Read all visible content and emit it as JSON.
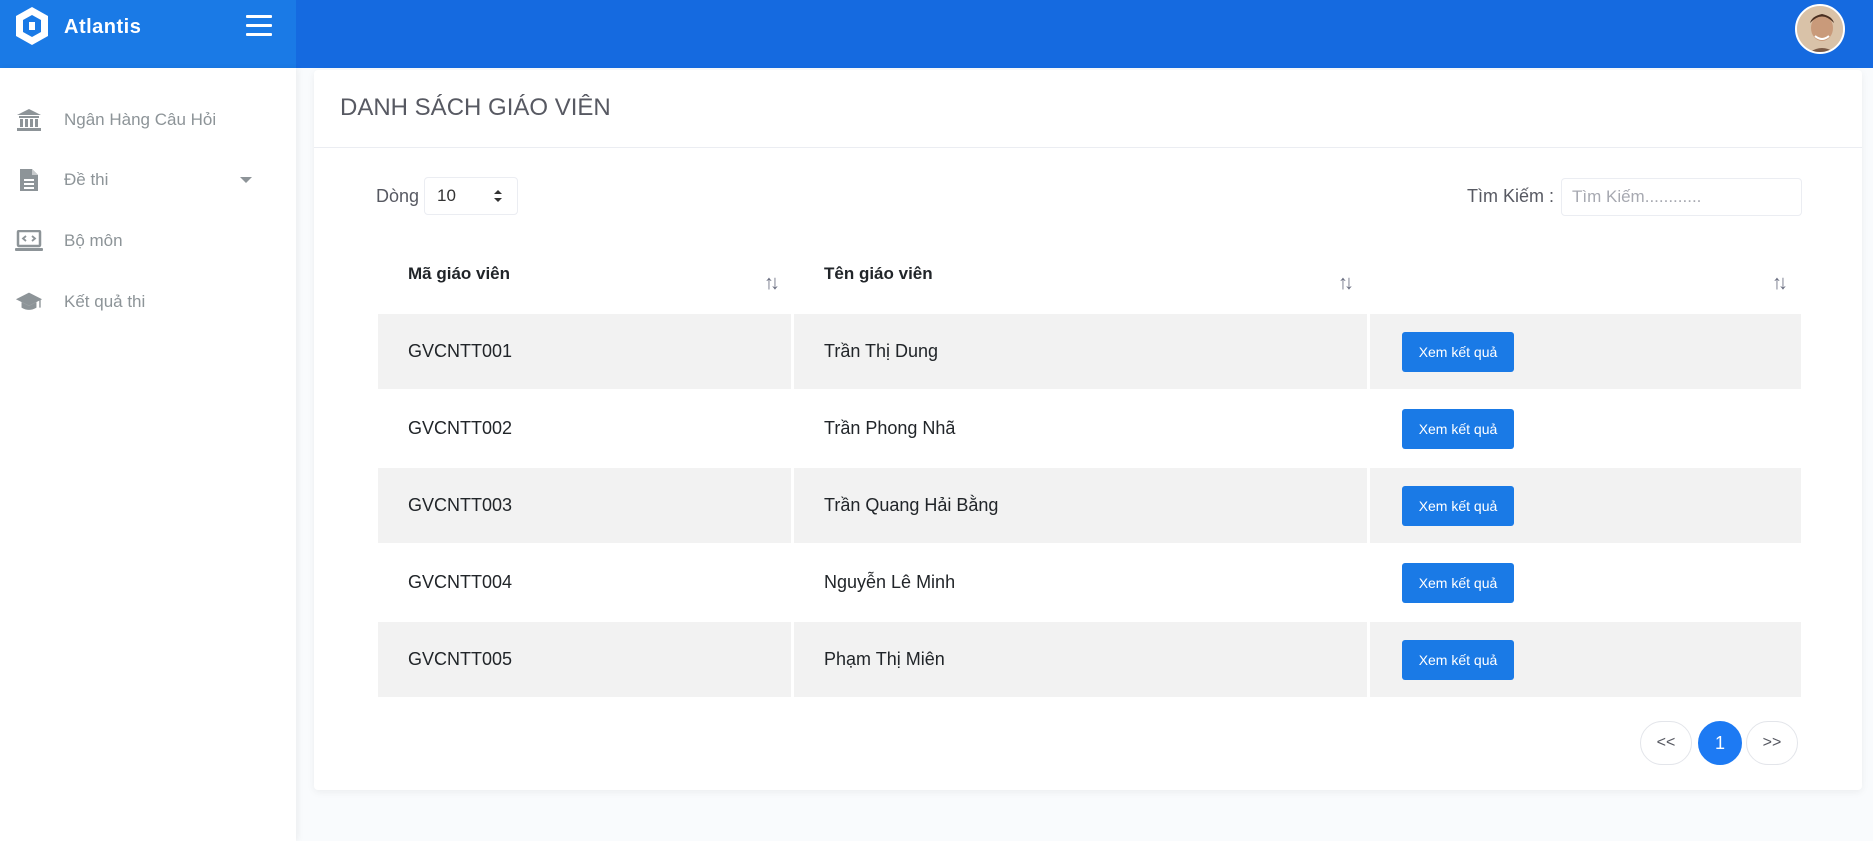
{
  "app": {
    "name": "Atlantis",
    "accent_color": "#1a7ae6",
    "header_color": "#156ae0"
  },
  "sidebar": {
    "items": [
      {
        "label": "Ngân Hàng Câu Hỏi",
        "icon": "bank-icon"
      },
      {
        "label": "Đề thi",
        "icon": "file-icon",
        "has_dropdown": true
      },
      {
        "label": "Bộ môn",
        "icon": "laptop-code-icon"
      },
      {
        "label": "Kết quả thi",
        "icon": "graduation-cap-icon"
      }
    ]
  },
  "page": {
    "title": "DANH SÁCH GIÁO VIÊN"
  },
  "controls": {
    "rows_label": "Dòng",
    "rows_value": "10",
    "search_label": "Tìm Kiếm :",
    "search_placeholder": "Tìm Kiếm............",
    "search_value": ""
  },
  "table": {
    "columns": [
      "Mã giáo viên",
      "Tên giáo viên",
      ""
    ],
    "sort_icon": "↑↓",
    "rows": [
      {
        "id": "GVCNTT001",
        "name": "Trần Thị Dung",
        "action": "Xem kết quả"
      },
      {
        "id": "GVCNTT002",
        "name": "Trần Phong Nhã",
        "action": "Xem kết quả"
      },
      {
        "id": "GVCNTT003",
        "name": "Trần Quang Hải Bằng",
        "action": "Xem kết quả"
      },
      {
        "id": "GVCNTT004",
        "name": "Nguyễn Lê Minh",
        "action": "Xem kết quả"
      },
      {
        "id": "GVCNTT005",
        "name": "Phạm Thị Miên",
        "action": "Xem kết quả"
      }
    ]
  },
  "pagination": {
    "prev": "<<",
    "current": "1",
    "next": ">>"
  }
}
